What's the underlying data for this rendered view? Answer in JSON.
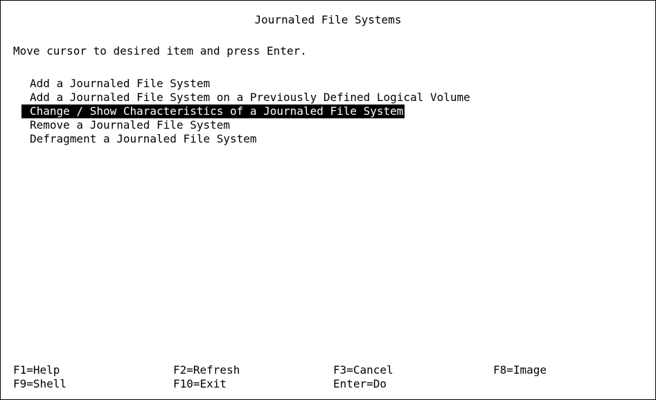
{
  "screen": {
    "title": "Journaled File Systems",
    "instructions": "Move cursor to desired item and press Enter."
  },
  "menu": {
    "items": [
      {
        "label": "Add a Journaled File System",
        "selected": false
      },
      {
        "label": "Add a Journaled File System on a Previously Defined Logical Volume",
        "selected": false
      },
      {
        "label": "Change / Show Characteristics of a Journaled File System",
        "selected": true
      },
      {
        "label": "Remove a Journaled File System",
        "selected": false
      },
      {
        "label": "Defragment a Journaled File System",
        "selected": false
      }
    ]
  },
  "function_keys": {
    "row1": [
      "F1=Help",
      "F2=Refresh",
      "F3=Cancel",
      "F8=Image"
    ],
    "row2": [
      "F9=Shell",
      "F10=Exit",
      "Enter=Do"
    ]
  },
  "colors": {
    "background": "#ffffff",
    "text": "#000000",
    "selection_background": "#000000",
    "selection_text": "#ffffff"
  }
}
